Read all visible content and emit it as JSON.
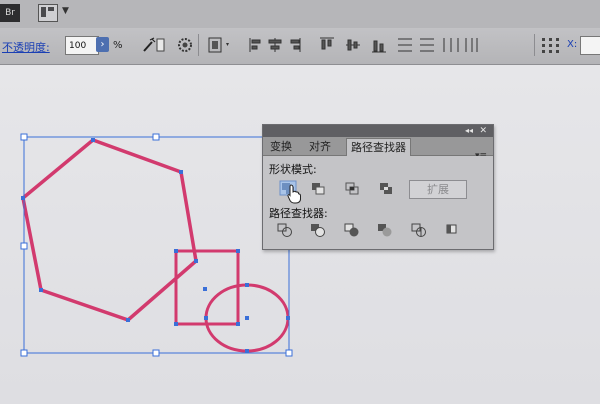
{
  "menubar": {
    "app_icon_label": "Br"
  },
  "toolbar": {
    "opacity_label": "不透明度:",
    "opacity_value": "100",
    "opacity_unit": "%",
    "coord_label": "X:"
  },
  "panel": {
    "tabs": [
      {
        "label": "变换",
        "active": false
      },
      {
        "label": "对齐",
        "active": false
      },
      {
        "label": "路径查找器",
        "active": true
      }
    ],
    "shape_modes_label": "形状模式:",
    "expand_label": "扩展",
    "pathfinders_label": "路径查找器:"
  },
  "colors": {
    "path_stroke": "#d23a6e",
    "selection": "#3a6fd8",
    "panel_bg": "#c4c4c7",
    "link_blue": "#1a3fb4"
  }
}
